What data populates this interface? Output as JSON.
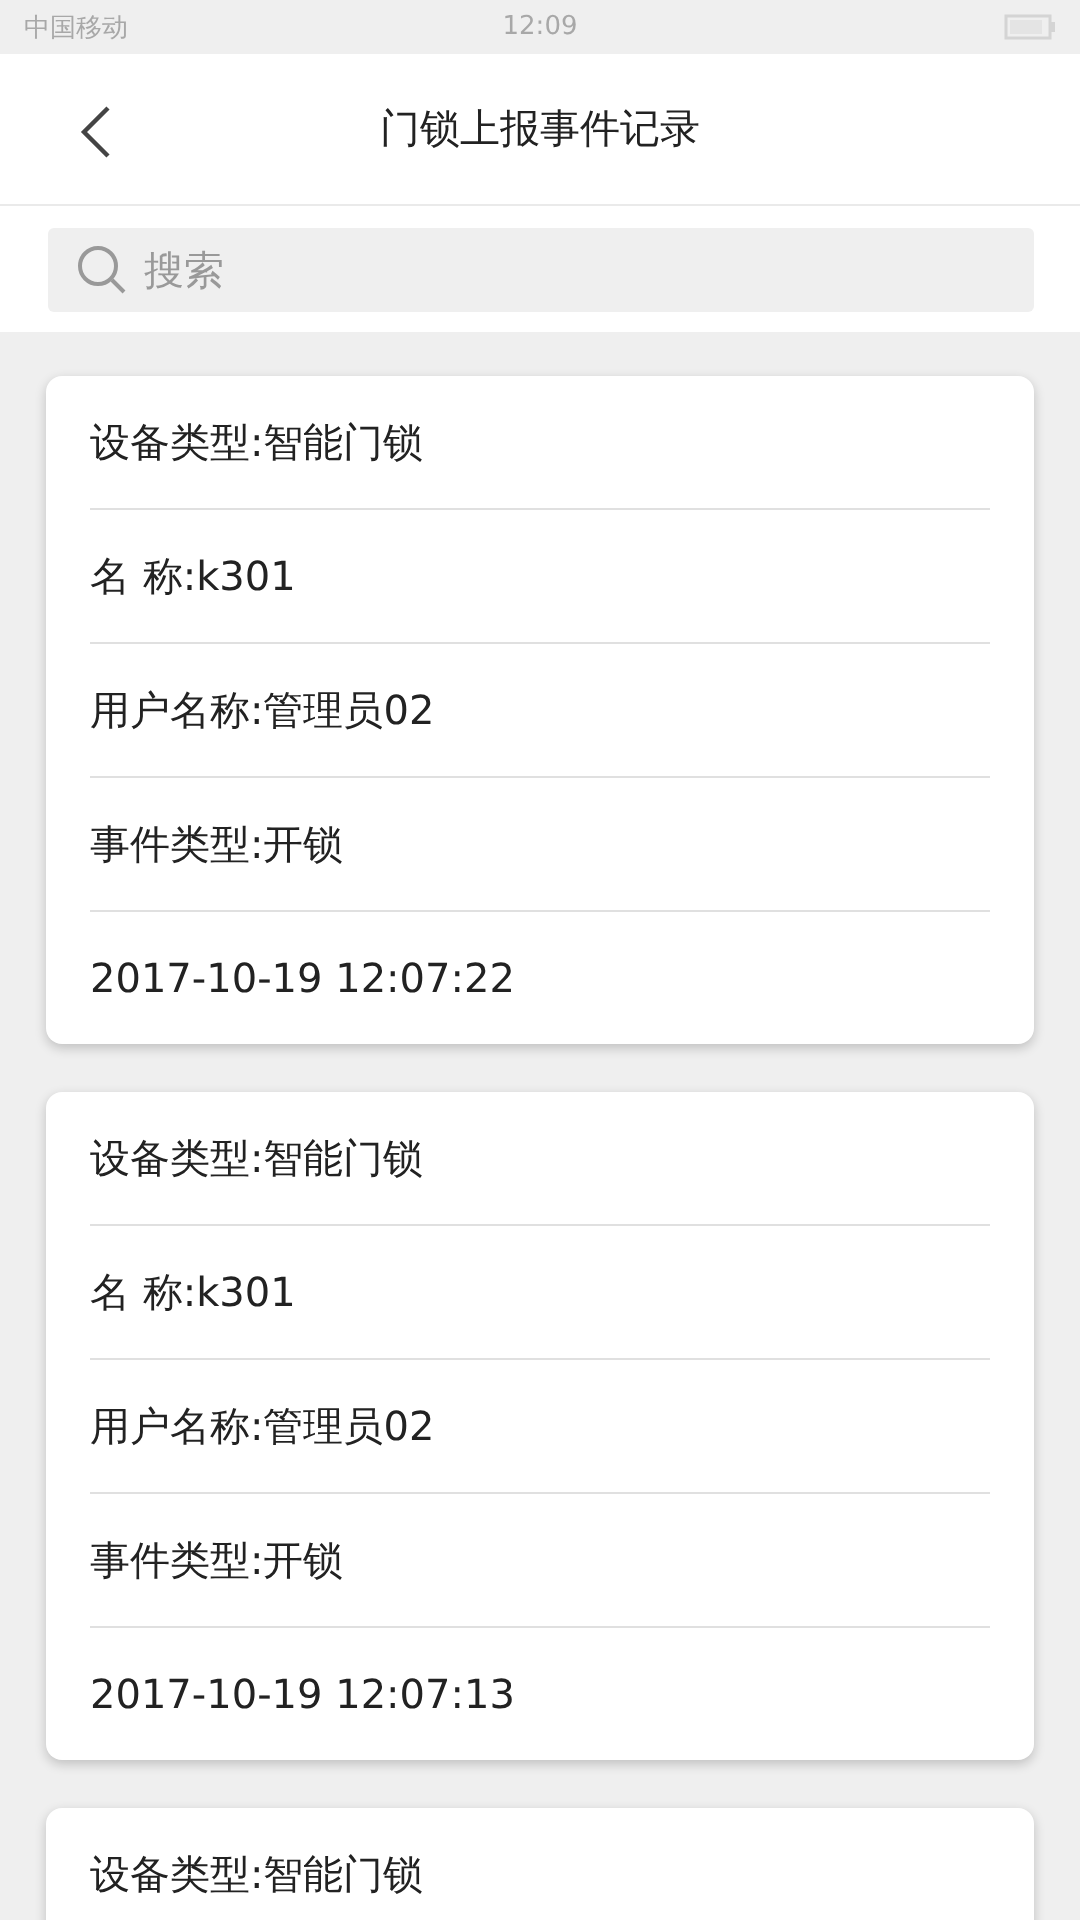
{
  "status_bar": {
    "carrier": "中国移动",
    "time": "12:09"
  },
  "header": {
    "title": "门锁上报事件记录"
  },
  "search": {
    "placeholder": "搜索"
  },
  "records": [
    {
      "lines": [
        "设备类型:智能门锁",
        "名 称:k301",
        "用户名称:管理员02",
        "事件类型:开锁",
        "2017-10-19 12:07:22"
      ]
    },
    {
      "lines": [
        "设备类型:智能门锁",
        "名 称:k301",
        "用户名称:管理员02",
        "事件类型:开锁",
        "2017-10-19 12:07:13"
      ]
    },
    {
      "lines": [
        "设备类型:智能门锁"
      ]
    }
  ]
}
